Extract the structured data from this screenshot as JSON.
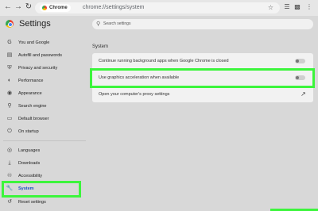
{
  "browser": {
    "back_icon": "back-arrow-icon",
    "forward_icon": "forward-arrow-icon",
    "reload_icon": "reload-icon",
    "site_chip": "Chrome",
    "url": "chrome://settings/system",
    "star_icon": "star-icon",
    "extensions_icon": "puzzle-icon"
  },
  "header": {
    "title": "Settings",
    "search_placeholder": "Search settings"
  },
  "sidebar": {
    "items": [
      {
        "label": "You and Google",
        "icon": "google-g-icon"
      },
      {
        "label": "Autofill and passwords",
        "icon": "clipboard-icon"
      },
      {
        "label": "Privacy and security",
        "icon": "shield-icon"
      },
      {
        "label": "Performance",
        "icon": "speedometer-icon"
      },
      {
        "label": "Appearance",
        "icon": "palette-icon"
      },
      {
        "label": "Search engine",
        "icon": "search-icon"
      },
      {
        "label": "Default browser",
        "icon": "browser-icon"
      },
      {
        "label": "On startup",
        "icon": "power-icon"
      },
      {
        "label": "Languages",
        "icon": "globe-icon"
      },
      {
        "label": "Downloads",
        "icon": "download-icon"
      },
      {
        "label": "Accessibility",
        "icon": "accessibility-icon"
      },
      {
        "label": "System",
        "icon": "wrench-icon",
        "active": true
      },
      {
        "label": "Reset settings",
        "icon": "reset-icon"
      }
    ]
  },
  "main": {
    "section_title": "System",
    "rows": [
      {
        "label": "Continue running background apps when Google Chrome is closed",
        "type": "toggle",
        "on": false
      },
      {
        "label": "Use graphics acceleration when available",
        "type": "toggle",
        "on": false
      },
      {
        "label": "Open your computer's proxy settings",
        "type": "external-link"
      }
    ]
  },
  "colors": {
    "highlight": "#3cf53c",
    "active_blue": "#1a4fc4"
  }
}
